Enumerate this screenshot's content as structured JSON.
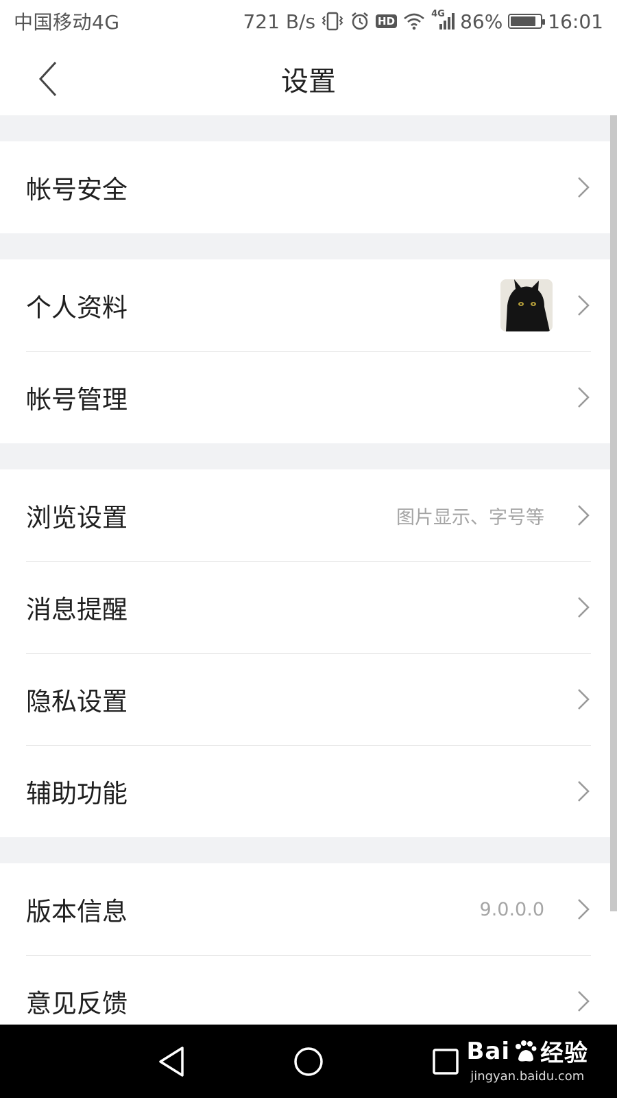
{
  "status_bar": {
    "carrier": "中国移动4G",
    "net_speed": "721 B/s",
    "signal_label": "4G",
    "battery": "86%",
    "battery_level": 0.86,
    "time": "16:01",
    "hd_badge": "HD"
  },
  "header": {
    "title": "设置"
  },
  "groups": [
    {
      "rows": [
        {
          "label": "帐号安全"
        }
      ]
    },
    {
      "rows": [
        {
          "label": "个人资料",
          "has_avatar": true
        },
        {
          "label": "帐号管理"
        }
      ]
    },
    {
      "rows": [
        {
          "label": "浏览设置",
          "value": "图片显示、字号等"
        },
        {
          "label": "消息提醒"
        },
        {
          "label": "隐私设置"
        },
        {
          "label": "辅助功能"
        }
      ]
    },
    {
      "rows": [
        {
          "label": "版本信息",
          "value": "9.0.0.0"
        },
        {
          "label": "意见反馈"
        }
      ]
    }
  ],
  "watermark": {
    "brand": "Bai",
    "brand_suffix": "经验",
    "url": "jingyan.baidu.com"
  },
  "colors": {
    "background": "#f1f2f4",
    "text": "#1f1f1f",
    "secondary_text": "#a5a5a5",
    "navbar": "#000000"
  }
}
